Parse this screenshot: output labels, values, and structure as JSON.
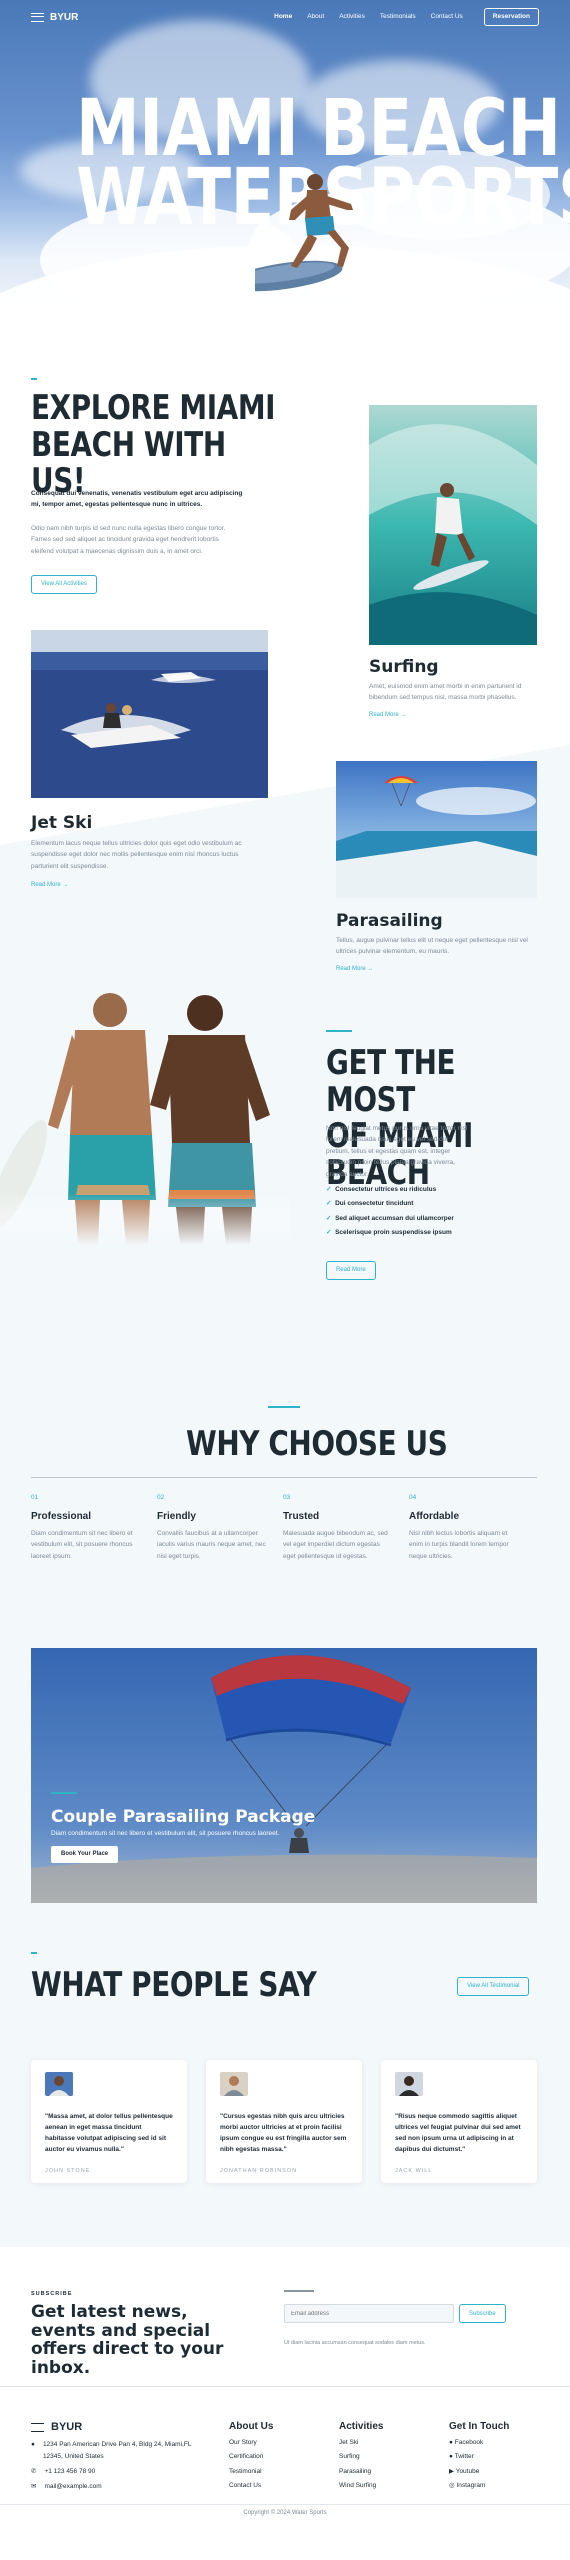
{
  "nav": {
    "brand": "BYUR",
    "links": [
      "Home",
      "About",
      "Activities",
      "Testimonials",
      "Contact Us"
    ],
    "reservation": "Reservation"
  },
  "hero": {
    "title_line1": "MIAMI BEACH",
    "title_line2": "WATERSPORTS"
  },
  "explore": {
    "title_line1": "EXPLORE MIAMI",
    "title_line2": "BEACH WITH US!",
    "lead": "Consequat dui venenatis, venenatis vestibulum eget arcu adipiscing mi, tempor amet, egestas pellentesque nunc in ultrices.",
    "body": "Odio nam nibh turpis id sed nunc nulla egestas libero congue tortor. Fames sed sed aliquet ac tincidunt gravida eget hendrerit lobortis eleifend volutpat a maecenas dignissim duis a, in amet orci.",
    "button": "View All Activities"
  },
  "activities": {
    "surfing": {
      "title": "Surfing",
      "text": "Amet, euismod enim amet morbi in enim parturient id bibendum sed tempus nisl, massa morbi phasellus.",
      "more": "Read More →"
    },
    "jetski": {
      "title": "Jet Ski",
      "text": "Elementum lacus neque tellus ultricies dolor quis eget odio vestibulum ac suspendisse eget dolor nec mollis pellentesque enim nisl rhoncus luctus parturient elit suspendisse.",
      "more": "Read More →"
    },
    "parasailing": {
      "title": "Parasailing",
      "text": "Tellus, augue pulvinar tellus elit ut neque eget pellentesque nisl vel ultrices pulvinar elementum, eu mauris.",
      "more": "Read More →"
    }
  },
  "most": {
    "title_line1": "GET THE MOST",
    "title_line2": "OF MIAMI BEACH",
    "body": "Non nisl feugiat metus purus urna vitae tortor nisl lorem malesuada risus eget eu vel sed dui pretium, tellus et egestas quam est, integer sollicitudin proin tellus platea gravida viverra, gravida auctor.",
    "list": [
      "Consectetur ultrices eu ridiculus",
      "Dui consectetur tincidunt",
      "Sed aliquet accumsan dui ullamcorper",
      "Scelerisque proin suspendisse ipsum"
    ],
    "button": "Read More"
  },
  "why": {
    "title": "WHY CHOOSE US",
    "features": [
      {
        "num": "01",
        "title": "Professional",
        "text": "Diam condimentum sit nec libero et vestibulum elit, sit posuere rhoncus laoreet ipsum."
      },
      {
        "num": "02",
        "title": "Friendly",
        "text": "Convallis faucibus at a ullamcorper iaculis varius mauris neque amet, nec nisl eget turpis."
      },
      {
        "num": "03",
        "title": "Trusted",
        "text": "Malesuada augue bibendum ac, sed vel eget imperdiet dictum egestas eget pellentesque id egestas."
      },
      {
        "num": "04",
        "title": "Affordable",
        "text": "Nisl nibh lectus lobortis aliquam et enim in turpis blandit lorem tempor neque ultricies."
      }
    ]
  },
  "package": {
    "title": "Couple Parasailing Package",
    "text": "Diam condimentum sit nec libero et vestibulum elit, sit posuere rhoncus laoreet.",
    "button": "Book Your Place"
  },
  "testimonials": {
    "title": "WHAT PEOPLE SAY",
    "button": "View All Testimonial",
    "items": [
      {
        "quote": "\"Massa amet, at dolor tellus pellentesque aenean in eget massa tincidunt habitasse volutpat adipiscing sed id sit auctor eu vivamus nulla.\"",
        "name": "JOHN STONE"
      },
      {
        "quote": "\"Cursus egestas nibh quis arcu ultricies morbi auctor ultricies at et proin facilisi ipsum congue eu est fringilla auctor sem nibh egestas massa.\"",
        "name": "JONATHAN ROBINSON"
      },
      {
        "quote": "\"Risus neque commodo sagittis aliquet ultrices vel feugiat pulvinar dui sed amet sed non ipsum urna ut adipiscing in at dapibus dui dictumst.\"",
        "name": "JACK WILL"
      }
    ]
  },
  "subscribe": {
    "label": "SUBSCRIBE",
    "title": "Get latest news, events and special offers direct to your inbox.",
    "placeholder": "Email address",
    "button": "Subscribe",
    "note": "Ut diam lacinia accumsan consequat sodales diam metus."
  },
  "footer": {
    "brand": "BYUR",
    "address": "1234 Pan American Drive Pan 4, Bldg 24, Miami,FL 12345, United States",
    "phone": "+1 123 456 78 90",
    "email": "mail@example.com",
    "about": {
      "title": "About Us",
      "links": [
        "Our Story",
        "Certification",
        "Testimonial",
        "Contact Us"
      ]
    },
    "activities": {
      "title": "Activities",
      "links": [
        "Jet Ski",
        "Surfing",
        "Parasailing",
        "Wind Surfing"
      ]
    },
    "touch": {
      "title": "Get In Touch",
      "links": [
        "Facebook",
        "Twitter",
        "Youtube",
        "Instagram"
      ]
    },
    "copyright": "Copyright © 2024 Water Sports"
  },
  "colors": {
    "accent": "#2fb3c9",
    "dark": "#1f2b33",
    "muted": "#7d8b95",
    "light_bg": "#f3f8fb"
  },
  "icons": [
    "menu-icon",
    "location-icon",
    "phone-icon",
    "mail-icon",
    "facebook-icon",
    "twitter-icon",
    "youtube-icon",
    "instagram-icon",
    "check-icon"
  ]
}
